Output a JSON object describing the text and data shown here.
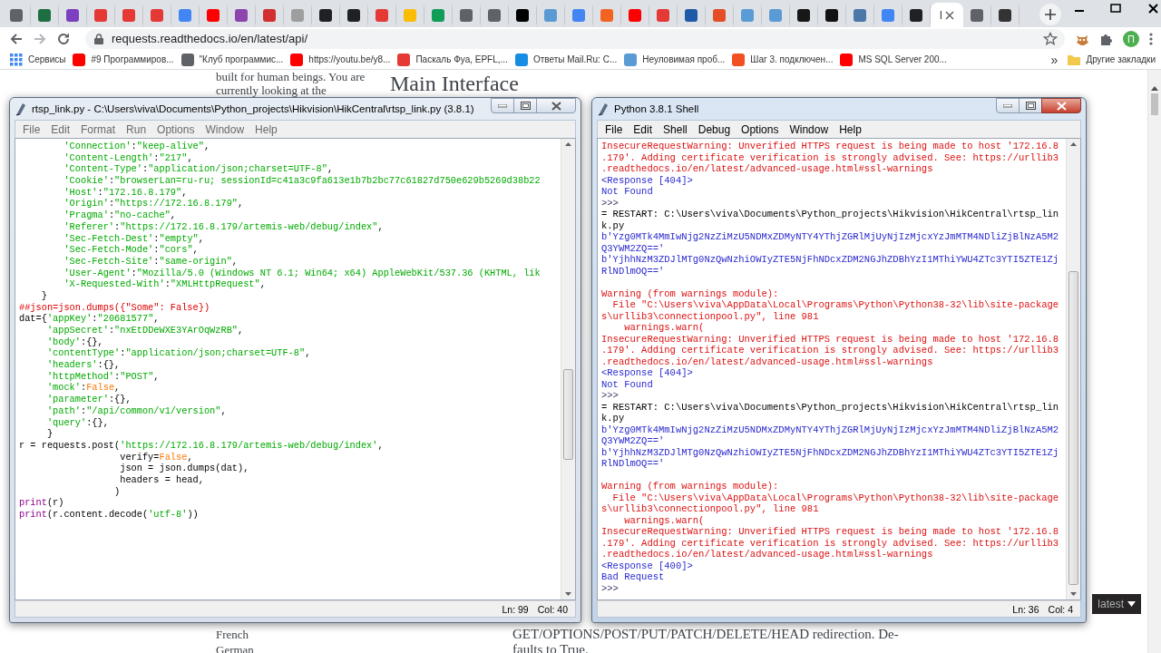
{
  "browser": {
    "tabs": [
      {
        "color": "#5f6368",
        "selected": false
      },
      {
        "color": "#1d6f42",
        "selected": false
      },
      {
        "color": "#7b3fbf",
        "selected": false
      },
      {
        "color": "#e53935",
        "selected": false
      },
      {
        "color": "#e53935",
        "selected": false
      },
      {
        "color": "#e53935",
        "selected": false
      },
      {
        "color": "#4285f4",
        "selected": false
      },
      {
        "color": "#ff0000",
        "selected": false
      },
      {
        "color": "#8e44ad",
        "selected": false
      },
      {
        "color": "#d32f2f",
        "selected": false
      },
      {
        "color": "#9e9e9e",
        "selected": false
      },
      {
        "color": "#202124",
        "selected": false
      },
      {
        "color": "#202124",
        "selected": false
      },
      {
        "color": "#e53935",
        "selected": false
      },
      {
        "color": "#fbbc04",
        "selected": false
      },
      {
        "color": "#0f9d58",
        "selected": false
      },
      {
        "color": "#5f6368",
        "selected": false
      },
      {
        "color": "#5f6368",
        "selected": false
      },
      {
        "color": "#000000",
        "selected": false
      },
      {
        "color": "#5b9bd5",
        "selected": false
      },
      {
        "color": "#4285f4",
        "selected": false
      },
      {
        "color": "#f26322",
        "selected": false
      },
      {
        "color": "#ff0000",
        "selected": false
      },
      {
        "color": "#e53935",
        "selected": false
      },
      {
        "color": "#1e5aa8",
        "selected": false
      },
      {
        "color": "#e44d26",
        "selected": false
      },
      {
        "color": "#5b9bd5",
        "selected": false
      },
      {
        "color": "#5b9bd5",
        "selected": false
      },
      {
        "color": "#181717",
        "selected": false
      },
      {
        "color": "#111111",
        "selected": false
      },
      {
        "color": "#4a76a8",
        "selected": false
      },
      {
        "color": "#4285f4",
        "selected": false
      },
      {
        "color": "#202124",
        "selected": false
      },
      {
        "title": "I",
        "selected": true
      },
      {
        "color": "#5f6368",
        "selected": false
      },
      {
        "color": "#333333",
        "selected": false
      }
    ],
    "address": {
      "url": "requests.readthedocs.io/en/latest/api/"
    },
    "profile": {
      "initial": "П"
    },
    "bookmarks": [
      {
        "kind": "apps",
        "label": "Сервисы",
        "color": "#4285f4"
      },
      {
        "kind": "link",
        "label": "#9 Программиров...",
        "color": "#ff0000"
      },
      {
        "kind": "link",
        "label": "\"Клуб программис...",
        "color": "#5f6368"
      },
      {
        "kind": "link",
        "label": "https://youtu.be/y8...",
        "color": "#ff0000"
      },
      {
        "kind": "link",
        "label": "Паскаль Фуа, EPFL,...",
        "color": "#e53935"
      },
      {
        "kind": "link",
        "label": "Ответы Mail.Ru: С...",
        "color": "#168de2"
      },
      {
        "kind": "link",
        "label": "Неуловимая проб...",
        "color": "#5b9bd5"
      },
      {
        "kind": "link",
        "label": "Шаг 3. подключен...",
        "color": "#f25022"
      },
      {
        "kind": "link",
        "label": "MS SQL Server 200...",
        "color": "#ff0000"
      }
    ],
    "bookmarks_overflow": "»",
    "other_bookmarks": "Другие закладки"
  },
  "page": {
    "sidebar_top": [
      "built for human beings. You are",
      "currently looking at the"
    ],
    "heading": "Main Interface",
    "sidebar_bottom": [
      "French",
      "German"
    ],
    "body_bottom": [
      "GET/OPTIONS/POST/PUT/PATCH/DELETE/HEAD redirection. De-",
      "faults to True."
    ],
    "version_badge": "latest"
  },
  "windows": [
    {
      "kind": "editor",
      "active": false,
      "title": "rtsp_link.py - C:\\Users\\viva\\Documents\\Python_projects\\Hikvision\\HikCentral\\rtsp_link.py (3.8.1)",
      "menu": [
        "File",
        "Edit",
        "Format",
        "Run",
        "Options",
        "Window",
        "Help"
      ],
      "lines": [
        [
          {
            "kind": "string",
            "text": "        'Connection'"
          },
          {
            "kind": "plain",
            "text": ":"
          },
          {
            "kind": "string",
            "text": "\"keep-alive\""
          },
          {
            "kind": "plain",
            "text": ","
          }
        ],
        [
          {
            "kind": "string",
            "text": "        'Content-Length'"
          },
          {
            "kind": "plain",
            "text": ":"
          },
          {
            "kind": "string",
            "text": "\"217\""
          },
          {
            "kind": "plain",
            "text": ","
          }
        ],
        [
          {
            "kind": "string",
            "text": "        'Content-Type'"
          },
          {
            "kind": "plain",
            "text": ":"
          },
          {
            "kind": "string",
            "text": "\"application/json;charset=UTF-8\""
          },
          {
            "kind": "plain",
            "text": ","
          }
        ],
        [
          {
            "kind": "string",
            "text": "        'Cookie'"
          },
          {
            "kind": "plain",
            "text": ":"
          },
          {
            "kind": "string",
            "text": "\"browserLan=ru-ru; sessionId=c41a3c9fa613e1b7b2bc77c61827d750e629b5269d38b22"
          }
        ],
        [
          {
            "kind": "string",
            "text": "        'Host'"
          },
          {
            "kind": "plain",
            "text": ":"
          },
          {
            "kind": "string",
            "text": "\"172.16.8.179\""
          },
          {
            "kind": "plain",
            "text": ","
          }
        ],
        [
          {
            "kind": "string",
            "text": "        'Origin'"
          },
          {
            "kind": "plain",
            "text": ":"
          },
          {
            "kind": "string",
            "text": "\"https://172.16.8.179\""
          },
          {
            "kind": "plain",
            "text": ","
          }
        ],
        [
          {
            "kind": "string",
            "text": "        'Pragma'"
          },
          {
            "kind": "plain",
            "text": ":"
          },
          {
            "kind": "string",
            "text": "\"no-cache\""
          },
          {
            "kind": "plain",
            "text": ","
          }
        ],
        [
          {
            "kind": "string",
            "text": "        'Referer'"
          },
          {
            "kind": "plain",
            "text": ":"
          },
          {
            "kind": "string",
            "text": "\"https://172.16.8.179/artemis-web/debug/index\""
          },
          {
            "kind": "plain",
            "text": ","
          }
        ],
        [
          {
            "kind": "string",
            "text": "        'Sec-Fetch-Dest'"
          },
          {
            "kind": "plain",
            "text": ":"
          },
          {
            "kind": "string",
            "text": "\"empty\""
          },
          {
            "kind": "plain",
            "text": ","
          }
        ],
        [
          {
            "kind": "string",
            "text": "        'Sec-Fetch-Mode'"
          },
          {
            "kind": "plain",
            "text": ":"
          },
          {
            "kind": "string",
            "text": "\"cors\""
          },
          {
            "kind": "plain",
            "text": ","
          }
        ],
        [
          {
            "kind": "string",
            "text": "        'Sec-Fetch-Site'"
          },
          {
            "kind": "plain",
            "text": ":"
          },
          {
            "kind": "string",
            "text": "\"same-origin\""
          },
          {
            "kind": "plain",
            "text": ","
          }
        ],
        [
          {
            "kind": "string",
            "text": "        'User-Agent'"
          },
          {
            "kind": "plain",
            "text": ":"
          },
          {
            "kind": "string",
            "text": "\"Mozilla/5.0 (Windows NT 6.1; Win64; x64) AppleWebKit/537.36 (KHTML, lik"
          }
        ],
        [
          {
            "kind": "string",
            "text": "        'X-Requested-With'"
          },
          {
            "kind": "plain",
            "text": ":"
          },
          {
            "kind": "string",
            "text": "\"XMLHttpRequest\""
          },
          {
            "kind": "plain",
            "text": ","
          }
        ],
        [
          {
            "kind": "plain",
            "text": "    }"
          }
        ],
        [
          {
            "kind": "comment",
            "text": "##json=json.dumps({\"Some\": False})"
          }
        ],
        [
          {
            "kind": "plain",
            "text": "dat={"
          },
          {
            "kind": "string",
            "text": "'appKey'"
          },
          {
            "kind": "plain",
            "text": ":"
          },
          {
            "kind": "string",
            "text": "\"20681577\""
          },
          {
            "kind": "plain",
            "text": ","
          }
        ],
        [
          {
            "kind": "string",
            "text": "     'appSecret'"
          },
          {
            "kind": "plain",
            "text": ":"
          },
          {
            "kind": "string",
            "text": "\"nxEtDDeWXE3YArOqWzRB\""
          },
          {
            "kind": "plain",
            "text": ","
          }
        ],
        [
          {
            "kind": "string",
            "text": "     'body'"
          },
          {
            "kind": "plain",
            "text": ":{},"
          }
        ],
        [
          {
            "kind": "string",
            "text": "     'contentType'"
          },
          {
            "kind": "plain",
            "text": ":"
          },
          {
            "kind": "string",
            "text": "\"application/json;charset=UTF-8\""
          },
          {
            "kind": "plain",
            "text": ","
          }
        ],
        [
          {
            "kind": "string",
            "text": "     'headers'"
          },
          {
            "kind": "plain",
            "text": ":{},"
          }
        ],
        [
          {
            "kind": "string",
            "text": "     'httpMethod'"
          },
          {
            "kind": "plain",
            "text": ":"
          },
          {
            "kind": "string",
            "text": "\"POST\""
          },
          {
            "kind": "plain",
            "text": ","
          }
        ],
        [
          {
            "kind": "string",
            "text": "     'mock'"
          },
          {
            "kind": "plain",
            "text": ":"
          },
          {
            "kind": "keyword",
            "text": "False"
          },
          {
            "kind": "plain",
            "text": ","
          }
        ],
        [
          {
            "kind": "string",
            "text": "     'parameter'"
          },
          {
            "kind": "plain",
            "text": ":{},"
          }
        ],
        [
          {
            "kind": "string",
            "text": "     'path'"
          },
          {
            "kind": "plain",
            "text": ":"
          },
          {
            "kind": "string",
            "text": "\"/api/common/v1/version\""
          },
          {
            "kind": "plain",
            "text": ","
          }
        ],
        [
          {
            "kind": "string",
            "text": "     'query'"
          },
          {
            "kind": "plain",
            "text": ":{},"
          }
        ],
        [
          {
            "kind": "plain",
            "text": "     }"
          }
        ],
        [
          {
            "kind": "plain",
            "text": "r = requests.post("
          },
          {
            "kind": "string",
            "text": "'https://172.16.8.179/artemis-web/debug/index'"
          },
          {
            "kind": "plain",
            "text": ","
          }
        ],
        [
          {
            "kind": "plain",
            "text": "                  verify="
          },
          {
            "kind": "keyword",
            "text": "False"
          },
          {
            "kind": "plain",
            "text": ","
          }
        ],
        [
          {
            "kind": "plain",
            "text": "                  json = json.dumps(dat),"
          }
        ],
        [
          {
            "kind": "plain",
            "text": "                  headers = head,"
          }
        ],
        [
          {
            "kind": "plain",
            "text": "                 )"
          }
        ],
        [
          {
            "kind": "builtin",
            "text": "print"
          },
          {
            "kind": "plain",
            "text": "(r)"
          }
        ],
        [
          {
            "kind": "builtin",
            "text": "print"
          },
          {
            "kind": "plain",
            "text": "(r.content.decode("
          },
          {
            "kind": "string",
            "text": "'utf-8'"
          },
          {
            "kind": "plain",
            "text": "))"
          }
        ]
      ],
      "status": {
        "line": "Ln: 99",
        "col": "Col: 40"
      }
    },
    {
      "kind": "shell",
      "active": true,
      "title": "Python 3.8.1 Shell",
      "menu": [
        "File",
        "Edit",
        "Shell",
        "Debug",
        "Options",
        "Window",
        "Help"
      ],
      "lines": [
        {
          "kind": "stderr",
          "text": "InsecureRequestWarning: Unverified HTTPS request is being made to host '172.16.8"
        },
        {
          "kind": "stderr",
          "text": ".179'. Adding certificate verification is strongly advised. See: https://urllib3"
        },
        {
          "kind": "stderr",
          "text": ".readthedocs.io/en/latest/advanced-usage.html#ssl-warnings"
        },
        {
          "kind": "stdout",
          "text": "<Response [404]>"
        },
        {
          "kind": "stdout",
          "text": "Not Found"
        },
        {
          "kind": "prompt",
          "text": ">>>"
        },
        {
          "kind": "plain",
          "text": "= RESTART: C:\\Users\\viva\\Documents\\Python_projects\\Hikvision\\HikCentral\\rtsp_lin"
        },
        {
          "kind": "plain",
          "text": "k.py"
        },
        {
          "kind": "stdout",
          "text": "b'Yzg0MTk4MmIwNjg2NzZiMzU5NDMxZDMyNTY4YThjZGRlMjUyNjIzMjcxYzJmMTM4NDliZjBlNzA5M2"
        },
        {
          "kind": "stdout",
          "text": "Q3YWM2ZQ=='"
        },
        {
          "kind": "stdout",
          "text": "b'YjhhNzM3ZDJlMTg0NzQwNzhiOWIyZTE5NjFhNDcxZDM2NGJhZDBhYzI1MThiYWU4ZTc3YTI5ZTE1Zj"
        },
        {
          "kind": "stdout",
          "text": "RlNDlmOQ=='"
        },
        {
          "kind": "blank"
        },
        {
          "kind": "stderr",
          "text": "Warning (from warnings module):"
        },
        {
          "kind": "stderr",
          "text": "  File \"C:\\Users\\viva\\AppData\\Local\\Programs\\Python\\Python38-32\\lib\\site-package"
        },
        {
          "kind": "stderr",
          "text": "s\\urllib3\\connectionpool.py\", line 981"
        },
        {
          "kind": "stderr",
          "text": "    warnings.warn("
        },
        {
          "kind": "stderr",
          "text": "InsecureRequestWarning: Unverified HTTPS request is being made to host '172.16.8"
        },
        {
          "kind": "stderr",
          "text": ".179'. Adding certificate verification is strongly advised. See: https://urllib3"
        },
        {
          "kind": "stderr",
          "text": ".readthedocs.io/en/latest/advanced-usage.html#ssl-warnings"
        },
        {
          "kind": "stdout",
          "text": "<Response [404]>"
        },
        {
          "kind": "stdout",
          "text": "Not Found"
        },
        {
          "kind": "prompt",
          "text": ">>>"
        },
        {
          "kind": "plain",
          "text": "= RESTART: C:\\Users\\viva\\Documents\\Python_projects\\Hikvision\\HikCentral\\rtsp_lin"
        },
        {
          "kind": "plain",
          "text": "k.py"
        },
        {
          "kind": "stdout",
          "text": "b'Yzg0MTk4MmIwNjg2NzZiMzU5NDMxZDMyNTY4YThjZGRlMjUyNjIzMjcxYzJmMTM4NDliZjBlNzA5M2"
        },
        {
          "kind": "stdout",
          "text": "Q3YWM2ZQ=='"
        },
        {
          "kind": "stdout",
          "text": "b'YjhhNzM3ZDJlMTg0NzQwNzhiOWIyZTE5NjFhNDcxZDM2NGJhZDBhYzI1MThiYWU4ZTc3YTI5ZTE1Zj"
        },
        {
          "kind": "stdout",
          "text": "RlNDlmOQ=='"
        },
        {
          "kind": "blank"
        },
        {
          "kind": "stderr",
          "text": "Warning (from warnings module):"
        },
        {
          "kind": "stderr",
          "text": "  File \"C:\\Users\\viva\\AppData\\Local\\Programs\\Python\\Python38-32\\lib\\site-package"
        },
        {
          "kind": "stderr",
          "text": "s\\urllib3\\connectionpool.py\", line 981"
        },
        {
          "kind": "stderr",
          "text": "    warnings.warn("
        },
        {
          "kind": "stderr",
          "text": "InsecureRequestWarning: Unverified HTTPS request is being made to host '172.16.8"
        },
        {
          "kind": "stderr",
          "text": ".179'. Adding certificate verification is strongly advised. See: https://urllib3"
        },
        {
          "kind": "stderr",
          "text": ".readthedocs.io/en/latest/advanced-usage.html#ssl-warnings"
        },
        {
          "kind": "stdout",
          "text": "<Response [400]>"
        },
        {
          "kind": "stdout",
          "text": "Bad Request"
        },
        {
          "kind": "prompt",
          "text": ">>>"
        }
      ],
      "status": {
        "line": "Ln: 36",
        "col": "Col: 4"
      }
    }
  ]
}
